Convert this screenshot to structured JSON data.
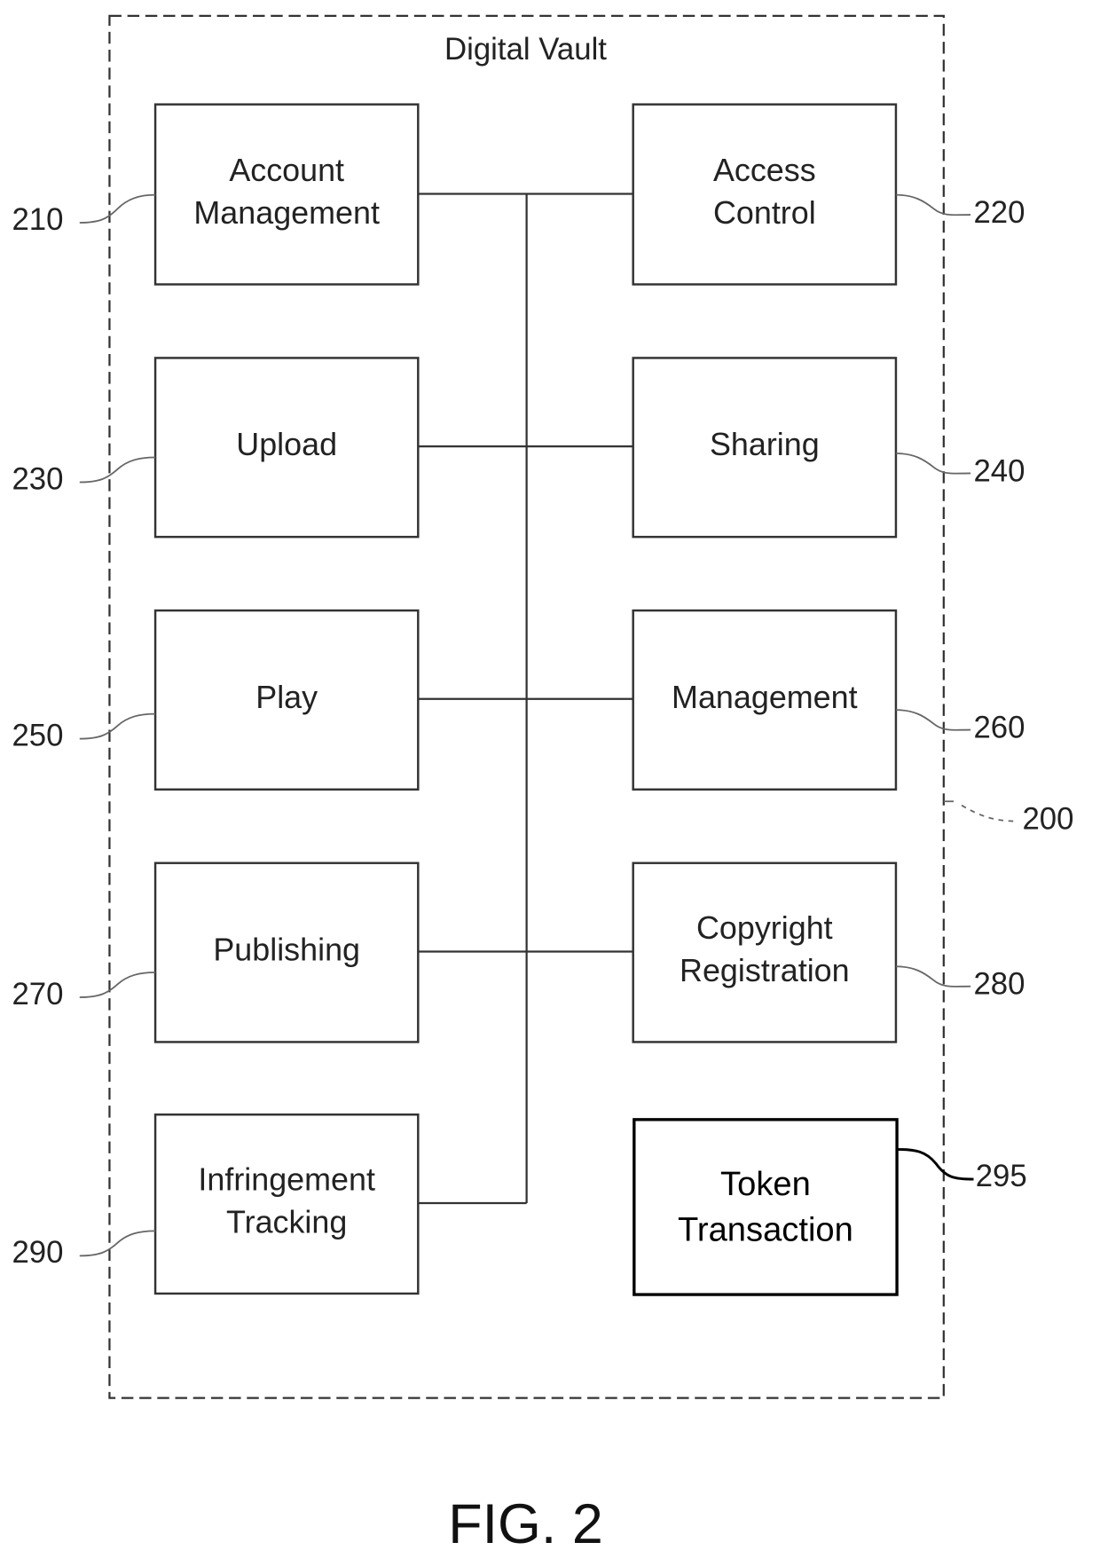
{
  "figure": {
    "caption": "FIG. 2",
    "container": {
      "title": "Digital Vault",
      "ref": "200"
    }
  },
  "modules": [
    {
      "id": "account-management",
      "lines": [
        "Account",
        "Management"
      ],
      "ref": "210"
    },
    {
      "id": "access-control",
      "lines": [
        "Access",
        "Control"
      ],
      "ref": "220"
    },
    {
      "id": "upload",
      "lines": [
        "Upload"
      ],
      "ref": "230"
    },
    {
      "id": "sharing",
      "lines": [
        "Sharing"
      ],
      "ref": "240"
    },
    {
      "id": "play",
      "lines": [
        "Play"
      ],
      "ref": "250"
    },
    {
      "id": "management",
      "lines": [
        "Management"
      ],
      "ref": "260"
    },
    {
      "id": "publishing",
      "lines": [
        "Publishing"
      ],
      "ref": "270"
    },
    {
      "id": "copyright-registration",
      "lines": [
        "Copyright",
        "Registration"
      ],
      "ref": "280"
    },
    {
      "id": "infringement-tracking",
      "lines": [
        "Infringement",
        "Tracking"
      ],
      "ref": "290"
    },
    {
      "id": "token-transaction",
      "lines": [
        "Token",
        "Transaction"
      ],
      "ref": "295"
    }
  ],
  "connections": {
    "bus": "shared vertical bus",
    "connected": [
      "account-management",
      "access-control",
      "upload",
      "sharing",
      "play",
      "management",
      "publishing",
      "copyright-registration",
      "infringement-tracking"
    ],
    "standalone": [
      "token-transaction"
    ]
  }
}
